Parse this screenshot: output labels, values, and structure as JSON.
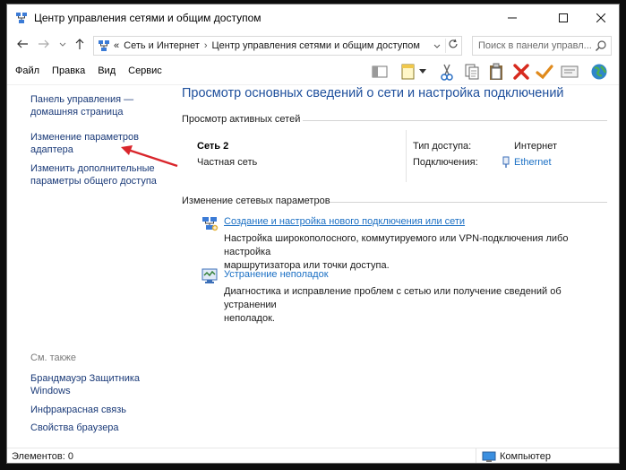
{
  "window": {
    "title": "Центр управления сетями и общим доступом",
    "icons": {
      "app": "network-center-icon",
      "minimize": "minimize-icon",
      "maximize": "maximize-icon",
      "close": "close-icon"
    }
  },
  "address_bar": {
    "prefix": "«",
    "crumbs": [
      "Сеть и Интернет",
      "Центр управления сетями и общим доступом"
    ],
    "separator": "›",
    "search_placeholder": "Поиск в панели управл..."
  },
  "menu": {
    "items": [
      "Файл",
      "Правка",
      "Вид",
      "Сервис"
    ]
  },
  "toolbar": {
    "icons": [
      "preview-pane-icon",
      "new-note-icon",
      "dropdown-icon",
      "cut-icon",
      "copy-icon",
      "paste-icon",
      "delete-icon",
      "check-icon",
      "properties-icon",
      "globe-icon"
    ]
  },
  "left_pane": {
    "home_link": [
      "Панель управления —",
      "домашняя страница"
    ],
    "adapter_link": [
      "Изменение параметров",
      "адаптера"
    ],
    "sharing_link": [
      "Изменить дополнительные",
      "параметры общего доступа"
    ],
    "see_also_title": "См. также",
    "see_also": {
      "firewall": [
        "Брандмауэр Защитника",
        "Windows"
      ],
      "infrared": "Инфракрасная связь",
      "browser": "Свойства браузера"
    }
  },
  "main": {
    "heading": "Просмотр основных сведений о сети и настройка подключений",
    "active_networks_title": "Просмотр активных сетей",
    "network": {
      "name": "Сеть 2",
      "type": "Частная сеть",
      "access_type_label": "Тип доступа:",
      "access_type_value": "Интернет",
      "connections_label": "Подключения:",
      "connections_value": "Ethernet"
    },
    "change_settings_title": "Изменение сетевых параметров",
    "tasks": [
      {
        "icon": "new-connection-icon",
        "link": "Создание и настройка нового подключения или сети",
        "description": [
          "Настройка широкополосного, коммутируемого или VPN-подключения либо настройка",
          "маршрутизатора или точки доступа."
        ]
      },
      {
        "icon": "troubleshoot-icon",
        "link": "Устранение неполадок",
        "description": [
          "Диагностика и исправление проблем с сетью или получение сведений об устранении",
          "неполадок."
        ]
      }
    ]
  },
  "status_bar": {
    "items_text": "Элементов: 0",
    "zone_text": "Компьютер"
  },
  "colors": {
    "heading": "#1e4f9c",
    "link": "#1a6fc4",
    "left_link": "#1a3a78",
    "annotation_arrow": "#d9262c"
  }
}
